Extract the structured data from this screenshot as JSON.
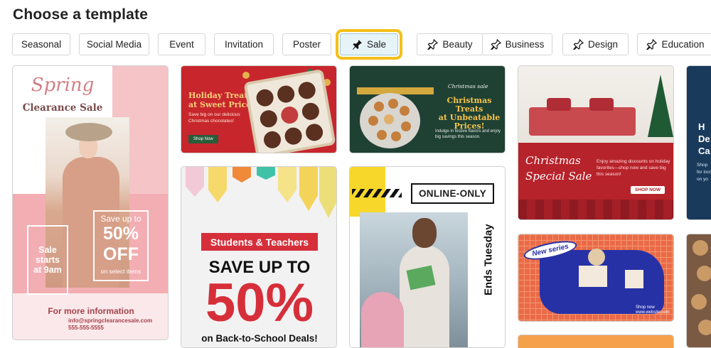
{
  "header": {
    "title": "Choose a template"
  },
  "chips": [
    {
      "label": "Seasonal",
      "icon": null
    },
    {
      "label": "Social Media",
      "icon": null
    },
    {
      "label": "Event",
      "icon": null
    },
    {
      "label": "Invitation",
      "icon": null
    },
    {
      "label": "Poster",
      "icon": null
    },
    {
      "label": "Sale",
      "icon": "pin-filled-icon",
      "selected": true
    },
    {
      "label": "Beauty",
      "icon": "pin-outline-icon"
    },
    {
      "label": "Business",
      "icon": "pin-outline-icon"
    },
    {
      "label": "Design",
      "icon": "pin-outline-icon"
    },
    {
      "label": "Education",
      "icon": "pin-outline-icon"
    }
  ],
  "templates": {
    "spring": {
      "title": "Spring",
      "subtitle": "Clearance Sale",
      "sale_starts": [
        "Sale",
        "starts",
        "at 9am"
      ],
      "save_up_to": "Save up to",
      "percent": "50%",
      "off": "OFF",
      "on_select": "on select items",
      "more_info": "For more information",
      "email": "info@springclearancesale.com",
      "phone": "555-555-5555"
    },
    "holiday": {
      "title_line1": "Holiday Treats",
      "title_line2": "at Sweet Prices!",
      "body": "Save big on our delicious Christmas chocolates!",
      "cta": "Shop Now"
    },
    "christmas_treats": {
      "tag": "Christmas sale",
      "title_line1": "Christmas Treats",
      "title_line2": "at Unbeatable",
      "title_line3": "Prices!",
      "body": "Indulge in festive flavors and enjoy big savings this season."
    },
    "christmas_special": {
      "title_line1": "Christmas",
      "title_line2": "Special Sale",
      "body": "Enjoy amazing discounts on holiday favorites—shop now and save big this season!",
      "cta": "SHOP NOW"
    },
    "partial_right": {
      "lines": [
        "H",
        "De",
        "Ca"
      ],
      "small": [
        "Shop",
        "for incr",
        "on yo"
      ]
    },
    "students": {
      "banner": "Students & Teachers",
      "headline": "SAVE UP TO",
      "percent": "50%",
      "footer": "on Back-to-School Deals!"
    },
    "online": {
      "badge": "ONLINE-ONLY",
      "vertical": "Ends Tuesday"
    },
    "new_series": {
      "badge": "New series",
      "cta_line1": "Shop now",
      "cta_line2": "www.website.com"
    }
  },
  "colors": {
    "accent_selected": "#f5bf17",
    "chip_selected_bg": "#e6f4f7",
    "sale_red": "#d62f3a"
  }
}
